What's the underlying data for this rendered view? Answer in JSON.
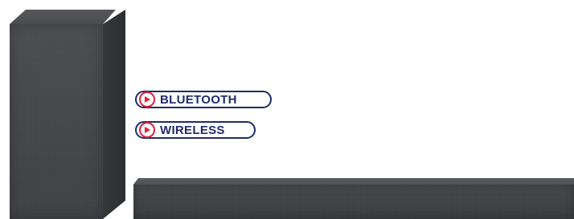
{
  "badges": [
    {
      "label": "BLUETOOTH",
      "icon": "play-circle-icon"
    },
    {
      "label": "WIRELESS",
      "icon": "play-circle-icon"
    }
  ],
  "colors": {
    "badge_border": "#1f2b6e",
    "badge_text": "#1f2b6e",
    "icon_accent": "#e1203a",
    "product_body": "#44464a",
    "background": "#ffffff"
  }
}
